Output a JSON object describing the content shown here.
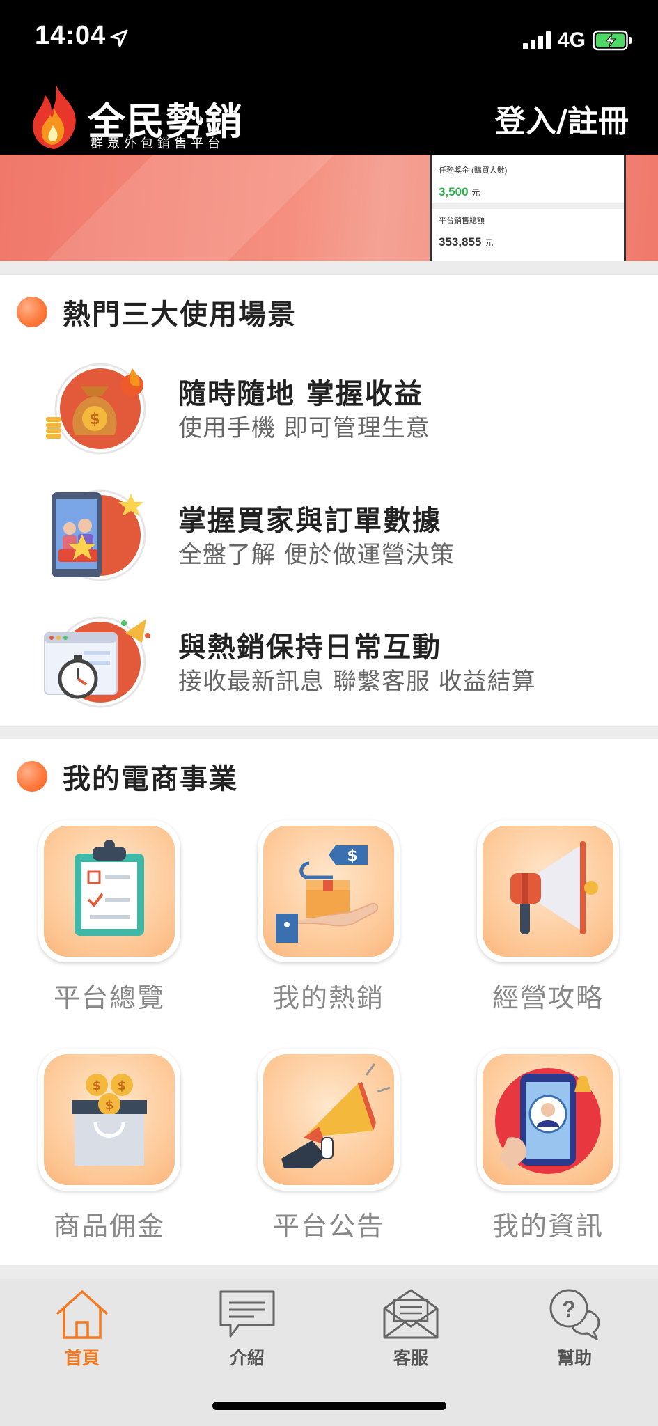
{
  "status_bar": {
    "time": "14:04",
    "network": "4G"
  },
  "header": {
    "brand_name": "全民勢銷",
    "brand_subtitle": "群眾外包銷售平台",
    "login_label": "登入/註冊"
  },
  "banner": {
    "task_bonus_label": "任務獎金 (購買人數)",
    "task_bonus_value": "3,500",
    "platform_sales_label": "平台銷售總額",
    "platform_sales_value": "353,855",
    "unit": "元",
    "value_color": "#2db24a"
  },
  "scenes": {
    "title": "熱門三大使用場景",
    "items": [
      {
        "title": "隨時隨地 掌握收益",
        "desc": "使用手機 即可管理生意",
        "icon": "money-bag-icon"
      },
      {
        "title": "掌握買家與訂單數據",
        "desc": "全盤了解 便於做運營決策",
        "icon": "phone-users-icon"
      },
      {
        "title": "與熱銷保持日常互動",
        "desc": "接收最新訊息 聯繫客服 收益結算",
        "icon": "stopwatch-icon"
      }
    ]
  },
  "business": {
    "title": "我的電商事業",
    "tiles": [
      {
        "label": "平台總覽",
        "icon": "clipboard-icon"
      },
      {
        "label": "我的熱銷",
        "icon": "hand-package-icon"
      },
      {
        "label": "經營攻略",
        "icon": "megaphone-icon"
      },
      {
        "label": "商品佣金",
        "icon": "coin-bag-icon"
      },
      {
        "label": "平台公告",
        "icon": "announcement-icon"
      },
      {
        "label": "我的資訊",
        "icon": "profile-phone-icon"
      }
    ]
  },
  "tabbar": {
    "items": [
      {
        "label": "首頁",
        "icon": "home-icon",
        "active": true
      },
      {
        "label": "介紹",
        "icon": "chat-icon",
        "active": false
      },
      {
        "label": "客服",
        "icon": "mail-icon",
        "active": false
      },
      {
        "label": "幫助",
        "icon": "help-icon",
        "active": false
      }
    ],
    "active_color": "#f47920"
  }
}
